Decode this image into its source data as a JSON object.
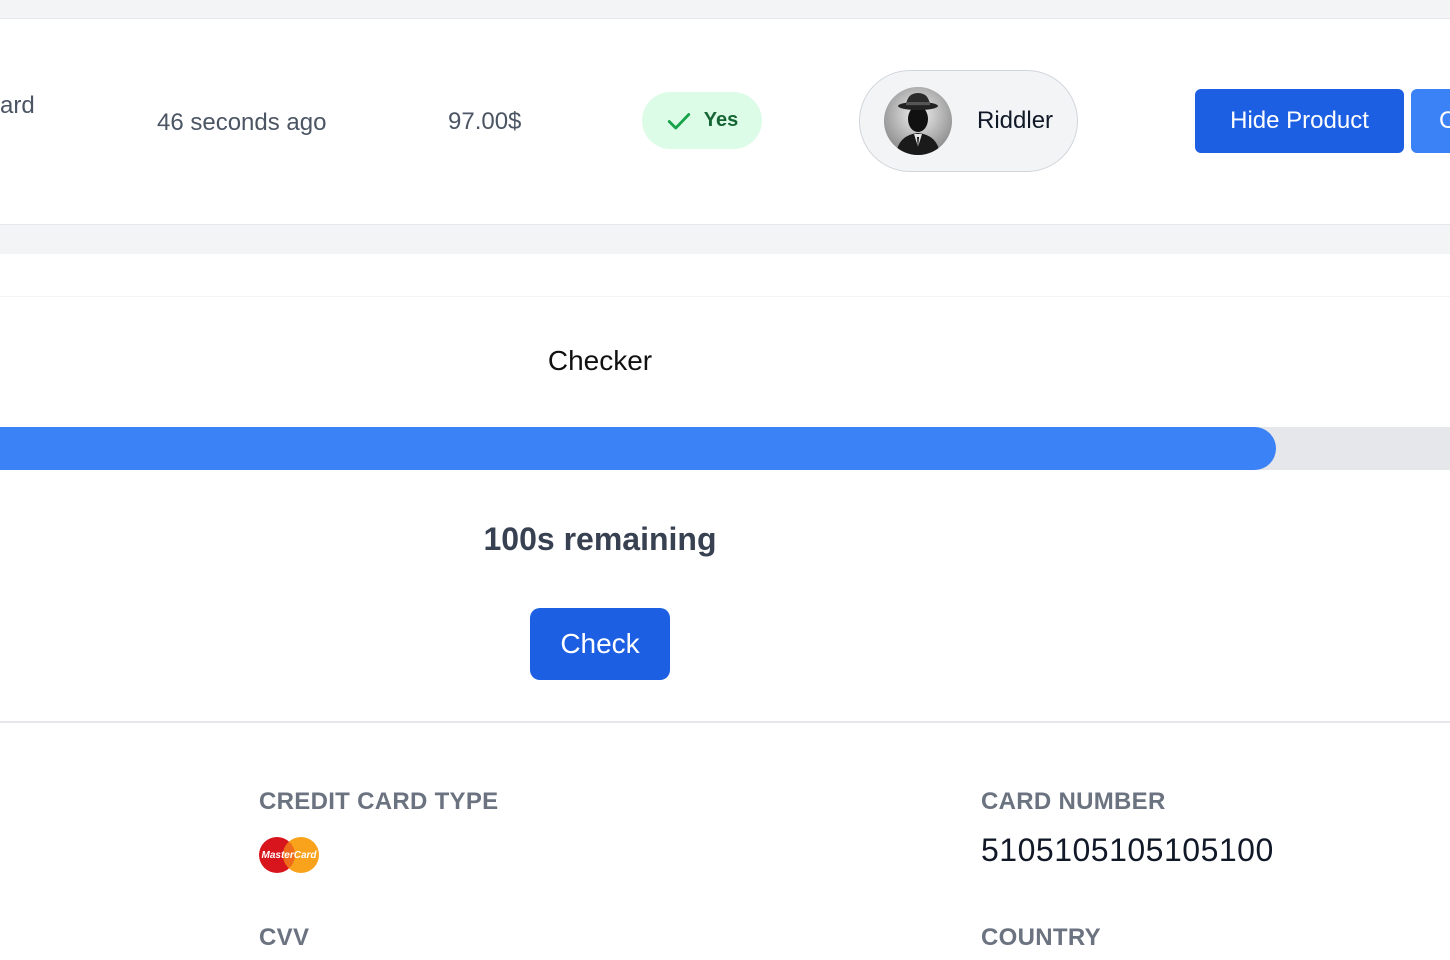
{
  "order_row": {
    "product_fragment": "ard",
    "time": "46 seconds ago",
    "price": "97.00$",
    "status_badge": "Yes",
    "seller_name": "Riddler",
    "hide_button_label": "Hide Product",
    "next_button_label": "C"
  },
  "checker": {
    "title": "Checker",
    "progress_fraction": 0.88,
    "remaining_text": "100s remaining",
    "check_button_label": "Check"
  },
  "details": {
    "card_type_label": "CREDIT CARD TYPE",
    "card_type_logo_text": "MasterCard",
    "card_number_label": "CARD NUMBER",
    "card_number_value": "5105105105105100",
    "cvv_label": "CVV",
    "country_label": "COUNTRY"
  },
  "icons": {
    "status": "check-icon",
    "card_brand": "mastercard-logo"
  },
  "colors": {
    "primary": "#1d5fe3",
    "accent": "#3b82f6",
    "success_bg": "#dcfce7",
    "success_text": "#166534"
  }
}
